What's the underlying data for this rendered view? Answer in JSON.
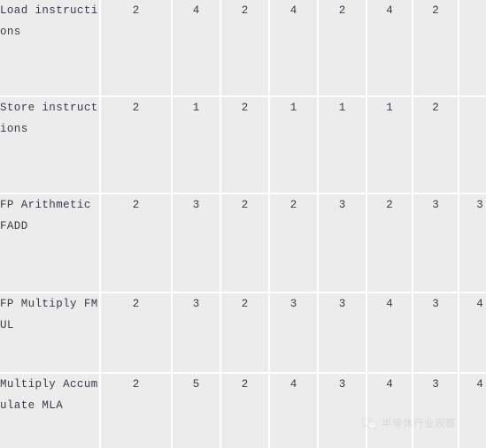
{
  "table": {
    "columns": [
      {
        "key": "label",
        "header": ""
      },
      {
        "key": "c1",
        "header": ""
      },
      {
        "key": "c2",
        "header": ""
      },
      {
        "key": "c3",
        "header": ""
      },
      {
        "key": "c4",
        "header": ""
      },
      {
        "key": "c5",
        "header": ""
      },
      {
        "key": "c6",
        "header": ""
      },
      {
        "key": "c7",
        "header": ""
      },
      {
        "key": "c8",
        "header": ""
      }
    ],
    "rows": [
      {
        "label": "Load instructions",
        "values": [
          "2",
          "4",
          "2",
          "4",
          "2",
          "4",
          "2",
          ""
        ]
      },
      {
        "label": "Store instructions",
        "values": [
          "2",
          "1",
          "2",
          "1",
          "1",
          "1",
          "2",
          ""
        ]
      },
      {
        "label": "FP Arithmetic FADD",
        "values": [
          "2",
          "3",
          "2",
          "2",
          "3",
          "2",
          "3",
          "3"
        ]
      },
      {
        "label": "FP Multiply FMUL",
        "values": [
          "2",
          "3",
          "2",
          "3",
          "3",
          "4",
          "3",
          "4"
        ]
      },
      {
        "label": "Multiply Accumulate MLA",
        "values": [
          "2",
          "5",
          "2",
          "4",
          "3",
          "4",
          "3",
          "4"
        ]
      }
    ]
  },
  "watermark": {
    "icon": "wechat-icon",
    "text": "半导体行业观察"
  },
  "colors": {
    "cell_background": "#ececec",
    "page_background": "#ffffff",
    "grid_line": "#ffffff",
    "label_text": "#2e3440",
    "value_text": "#4a4a58",
    "watermark_text": "#c8c8c8"
  }
}
